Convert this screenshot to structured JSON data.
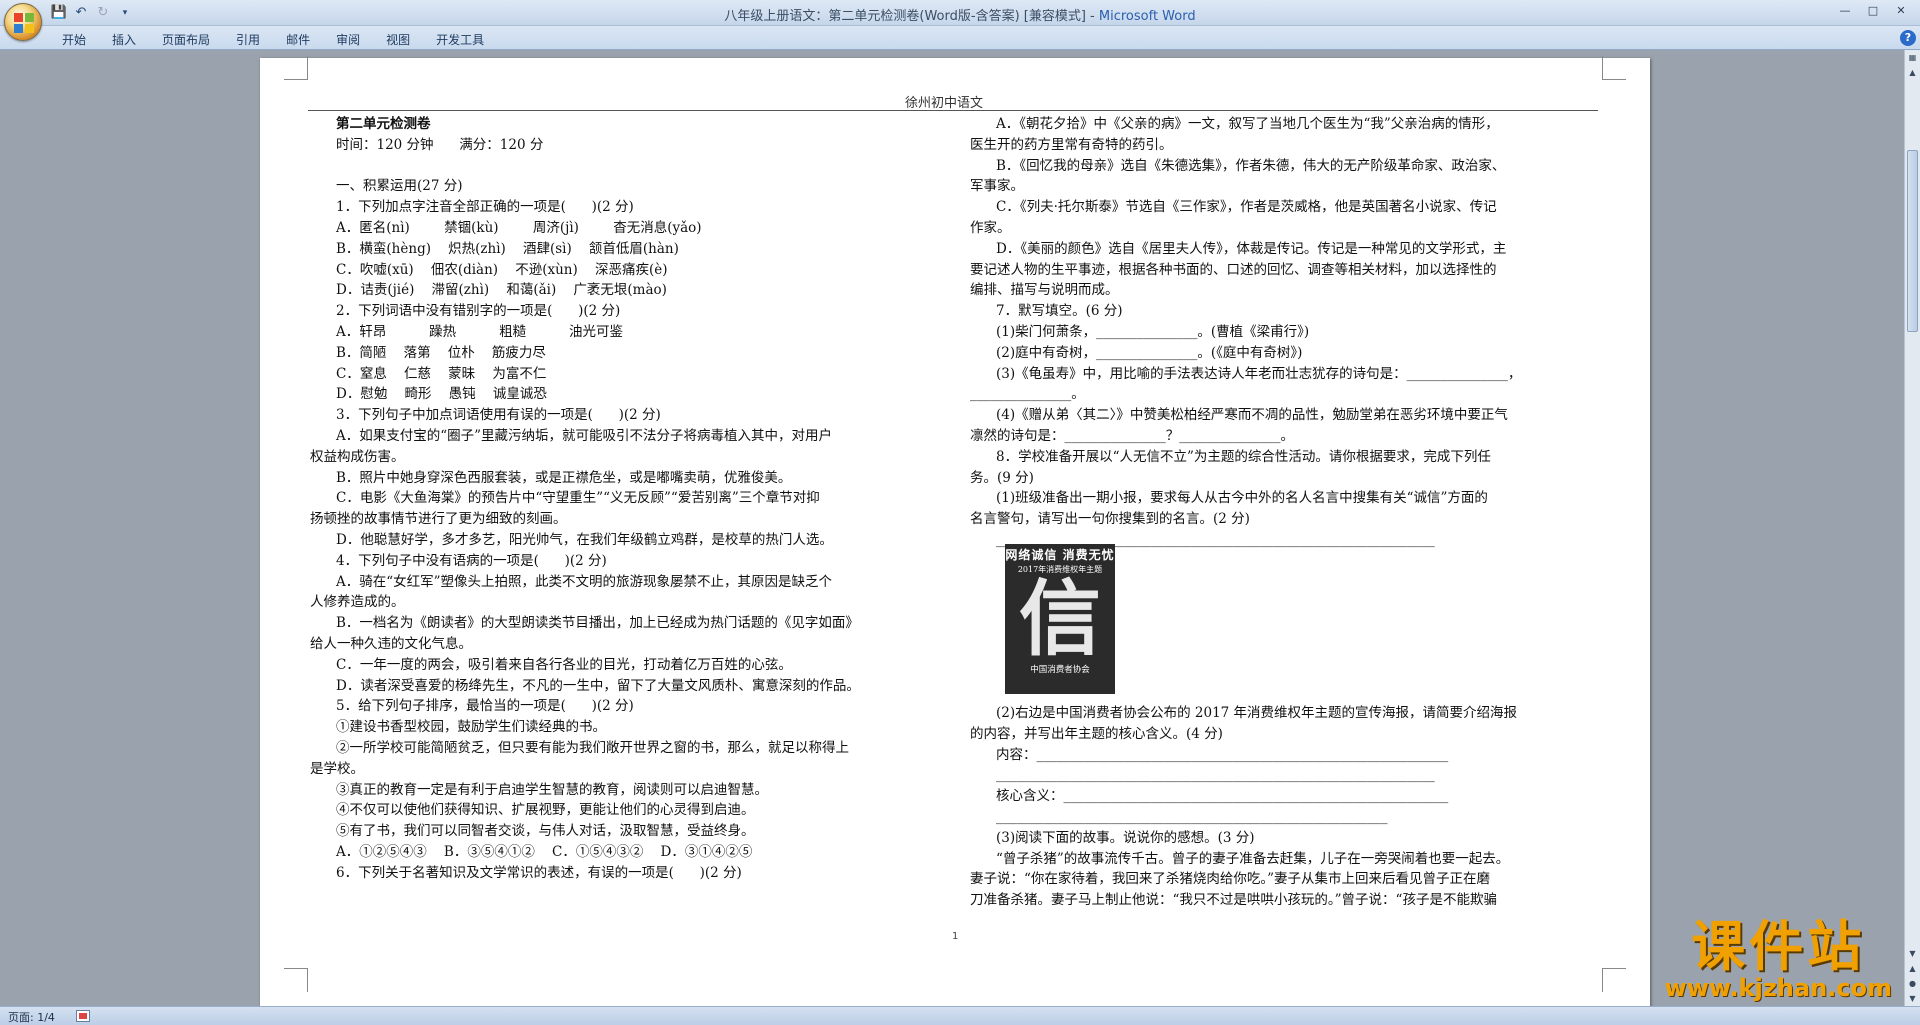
{
  "window": {
    "title": "八年级上册语文：第二单元检测卷(Word版-含答案) [兼容模式] - ",
    "app_name": "Microsoft Word",
    "controls": [
      "minimize-icon",
      "maximize-icon",
      "close-icon"
    ]
  },
  "ribbon": {
    "tabs": [
      "开始",
      "插入",
      "页面布局",
      "引用",
      "邮件",
      "审阅",
      "视图",
      "开发工具"
    ]
  },
  "doc": {
    "header": "徐州初中语文",
    "page_number": "1",
    "left_column": [
      {
        "text": "第二单元检测卷",
        "style": "bold"
      },
      {
        "text": "时间：120 分钟      满分：120 分",
        "style": ""
      },
      {
        "text": "",
        "style": ""
      },
      {
        "text": "一、积累运用(27 分)",
        "style": ""
      },
      {
        "text": "1．下列加点字注音全部正确的一项是(      )(2 分)",
        "style": ""
      },
      {
        "text": "A．匿名(nì)        禁锢(kù)        周济(jì)        杳无消息(yǎo)",
        "style": ""
      },
      {
        "text": "B．横蛮(hèng)    炽热(zhì)    酒肆(sì)    颔首低眉(hàn)",
        "style": ""
      },
      {
        "text": "C．吹嘘(xū)    佃农(diàn)    不逊(xùn)    深恶痛疾(è)",
        "style": ""
      },
      {
        "text": "D．诘责(jié)    滞留(zhì)    和蔼(ǎi)    广袤无垠(mào)",
        "style": ""
      },
      {
        "text": "2．下列词语中没有错别字的一项是(      )(2 分)",
        "style": ""
      },
      {
        "text": "A．轩昂          躁热          粗糙          油光可鉴",
        "style": ""
      },
      {
        "text": "B．简陋    落第    位朴    筋疲力尽",
        "style": ""
      },
      {
        "text": "C．窒息    仁慈    蒙昧    为富不仁",
        "style": ""
      },
      {
        "text": "D．慰勉    畸形    愚钝    诚皇诚恐",
        "style": ""
      },
      {
        "text": "3．下列句子中加点词语使用有误的一项是(      )(2 分)",
        "style": ""
      },
      {
        "text": "A．如果支付宝的“圈子”里藏污纳垢，就可能吸引不法分子将病毒植入其中，对用户",
        "style": "ind"
      },
      {
        "text": "权益构成伤害。",
        "style": "noind"
      },
      {
        "text": "B．照片中她身穿深色西服套装，或是正襟危坐，或是嘟嘴卖萌，优雅俊美。",
        "style": "ind"
      },
      {
        "text": "C．电影《大鱼海棠》的预告片中“守望重生”“义无反顾”“爱苦别离”三个章节对抑",
        "style": "ind"
      },
      {
        "text": "扬顿挫的故事情节进行了更为细致的刻画。",
        "style": "noind"
      },
      {
        "text": "D．他聪慧好学，多才多艺，阳光帅气，在我们年级鹤立鸡群，是校草的热门人选。",
        "style": "ind"
      },
      {
        "text": "4．下列句子中没有语病的一项是(      )(2 分)",
        "style": "ind"
      },
      {
        "text": "A．骑在“女红军”塑像头上拍照，此类不文明的旅游现象屡禁不止，其原因是缺乏个",
        "style": "ind"
      },
      {
        "text": "人修养造成的。",
        "style": "noind"
      },
      {
        "text": "B．一档名为《朗读者》的大型朗读类节目播出，加上已经成为热门话题的《见字如面》",
        "style": "ind"
      },
      {
        "text": "给人一种久违的文化气息。",
        "style": "noind"
      },
      {
        "text": "C．一年一度的两会，吸引着来自各行各业的目光，打动着亿万百姓的心弦。",
        "style": "ind"
      },
      {
        "text": "D．读者深受喜爱的杨绛先生，不凡的一生中，留下了大量文风质朴、寓意深刻的作品。",
        "style": "ind"
      },
      {
        "text": "5．给下列句子排序，最恰当的一项是(      )(2 分)",
        "style": "ind"
      },
      {
        "text": "①建设书香型校园，鼓励学生们读经典的书。",
        "style": "ind"
      },
      {
        "text": "②一所学校可能简陋贫乏，但只要有能为我们敞开世界之窗的书，那么，就足以称得上",
        "style": "ind"
      },
      {
        "text": "是学校。",
        "style": "noind"
      },
      {
        "text": "③真正的教育一定是有利于启迪学生智慧的教育，阅读则可以启迪智慧。",
        "style": "ind"
      },
      {
        "text": "④不仅可以使他们获得知识、扩展视野，更能让他们的心灵得到启迪。",
        "style": "ind"
      },
      {
        "text": "⑤有了书，我们可以同智者交谈，与伟人对话，汲取智慧，受益终身。",
        "style": "ind"
      },
      {
        "text": "A．①②⑤④③    B．③⑤④①②    C．①⑤④③②    D．③①④②⑤",
        "style": "ind"
      },
      {
        "text": "6．下列关于名著知识及文学常识的表述，有误的一项是(      )(2 分)",
        "style": "ind"
      }
    ],
    "right_column": [
      {
        "text": "A．《朝花夕拾》中《父亲的病》一文，叙写了当地几个医生为“我”父亲治病的情形，",
        "style": "ind"
      },
      {
        "text": "医生开的药方里常有奇特的药引。",
        "style": "noind"
      },
      {
        "text": "B．《回忆我的母亲》选自《朱德选集》，作者朱德，伟大的无产阶级革命家、政治家、",
        "style": "ind"
      },
      {
        "text": "军事家。",
        "style": "noind"
      },
      {
        "text": "C．《列夫·托尔斯泰》节选自《三作家》，作者是茨威格，他是英国著名小说家、传记",
        "style": "ind"
      },
      {
        "text": "作家。",
        "style": "noind"
      },
      {
        "text": "D．《美丽的颜色》选自《居里夫人传》，体裁是传记。传记是一种常见的文学形式，主",
        "style": "ind"
      },
      {
        "text": "要记述人物的生平事迹，根据各种书面的、口述的回忆、调查等相关材料，加以选择性的",
        "style": "noind"
      },
      {
        "text": "编排、描写与说明而成。",
        "style": "noind"
      },
      {
        "text": "7．默写填空。(6 分)",
        "style": "ind"
      },
      {
        "text": "(1)柴门何萧条，_______________。(曹植《梁甫行》)",
        "style": "ind"
      },
      {
        "text": "(2)庭中有奇树，_______________。(《庭中有奇树》)",
        "style": "ind"
      },
      {
        "text": "(3)《龟虽寿》中，用比喻的手法表达诗人年老而壮志犹存的诗句是：_______________，",
        "style": "ind"
      },
      {
        "text": "_______________。",
        "style": "noind"
      },
      {
        "text": "(4)《赠从弟〈其二〉》中赞美松柏经严寒而不凋的品性，勉励堂弟在恶劣环境中要正气",
        "style": "ind"
      },
      {
        "text": "凛然的诗句是：_______________？_______________。",
        "style": "noind"
      },
      {
        "text": "8．学校准备开展以“人无信不立”为主题的综合性活动。请你根据要求，完成下列任",
        "style": "ind"
      },
      {
        "text": "务。(9 分)",
        "style": "noind"
      },
      {
        "text": "(1)班级准备出一期小报，要求每人从古今中外的名人名言中搜集有关“诚信”方面的",
        "style": "ind"
      },
      {
        "text": "名言警句，请写出一句你搜集到的名言。(2 分)",
        "style": "noind"
      },
      {
        "text": "_________________________________________________________________",
        "style": "ind"
      }
    ],
    "right_column_bottom": [
      {
        "text": "(2)右边是中国消费者协会公布的 2017 年消费维权年主题的宣传海报，请简要介绍海报",
        "style": "ind"
      },
      {
        "text": "的内容，并写出年主题的核心含义。(4 分)",
        "style": "noind"
      },
      {
        "text": "内容：_____________________________________________________________",
        "style": "ind"
      },
      {
        "text": "_________________________________________________________________",
        "style": "ind"
      },
      {
        "text": "核心含义：_________________________________________________________",
        "style": "ind"
      },
      {
        "text": "__________________________________________________________",
        "style": "ind"
      },
      {
        "text": "(3)阅读下面的故事。说说你的感想。(3 分)",
        "style": "ind"
      },
      {
        "text": "“曾子杀猪”的故事流传千古。曾子的妻子准备去赶集，儿子在一旁哭闹着也要一起去。",
        "style": "ind"
      },
      {
        "text": "妻子说：“你在家待着，我回来了杀猪烧肉给你吃。”妻子从集市上回来后看见曾子正在磨",
        "style": "noind"
      },
      {
        "text": "刀准备杀猪。妻子马上制止他说：“我只不过是哄哄小孩玩的。”曾子说：“孩子是不能欺骗",
        "style": "noind"
      }
    ],
    "poster": {
      "title": "网络诚信 消费无忧",
      "subtitle": "2017年消费维权年主题",
      "glyph": "信",
      "footer": "中国消费者协会"
    }
  },
  "statusbar": {
    "page": "页面: 1/4"
  },
  "watermark": {
    "text": "课件站",
    "url": "www.kjzhan.com"
  },
  "colors": {
    "accent": "#2a5fb0",
    "watermark": "#f0a000"
  }
}
